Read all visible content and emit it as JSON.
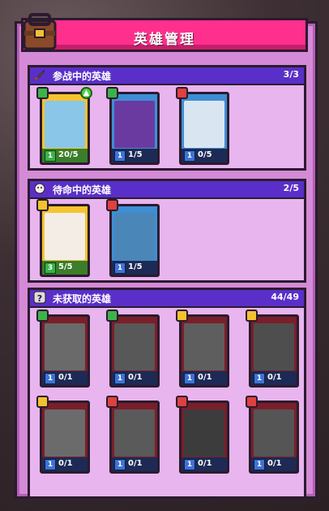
{
  "header": {
    "title": "英雄管理"
  },
  "sections": [
    {
      "title": "参战中的英雄",
      "count": "3/3",
      "heroes": [
        {
          "level": "1",
          "shards": "20/5",
          "frame": "gold",
          "badge": "green",
          "upgradable": true,
          "art": "#8ac6e8"
        },
        {
          "level": "1",
          "shards": "1/5",
          "frame": "blue",
          "badge": "green",
          "upgradable": false,
          "art": "#6b3aa1"
        },
        {
          "level": "1",
          "shards": "0/5",
          "frame": "blue",
          "badge": "red",
          "upgradable": false,
          "art": "#d9e6f2"
        }
      ]
    },
    {
      "title": "待命中的英雄",
      "count": "2/5",
      "heroes": [
        {
          "level": "3",
          "shards": "5/5",
          "frame": "gold",
          "badge": "yellow",
          "upgradable": false,
          "art": "#f3ede6"
        },
        {
          "level": "1",
          "shards": "1/5",
          "frame": "blue",
          "badge": "red",
          "upgradable": false,
          "art": "#4b86b8"
        }
      ]
    },
    {
      "title": "未获取的英雄",
      "count": "44/49",
      "heroes": [
        {
          "level": "1",
          "shards": "0/1",
          "frame": "dark",
          "badge": "green",
          "art": "#6a6a6a"
        },
        {
          "level": "1",
          "shards": "0/1",
          "frame": "dark",
          "badge": "green",
          "art": "#585858"
        },
        {
          "level": "1",
          "shards": "0/1",
          "frame": "dark",
          "badge": "yellow",
          "art": "#5e5e5e"
        },
        {
          "level": "1",
          "shards": "0/1",
          "frame": "dark",
          "badge": "yellow",
          "art": "#4e4e4e"
        },
        {
          "level": "1",
          "shards": "0/1",
          "frame": "dark",
          "badge": "yellow",
          "art": "#6b6b6b"
        },
        {
          "level": "1",
          "shards": "0/1",
          "frame": "dark",
          "badge": "red",
          "art": "#5a5a5a"
        },
        {
          "level": "1",
          "shards": "0/1",
          "frame": "dark",
          "badge": "red",
          "art": "#3c3c3c"
        },
        {
          "level": "1",
          "shards": "0/1",
          "frame": "dark",
          "badge": "red",
          "art": "#555555"
        }
      ]
    }
  ]
}
